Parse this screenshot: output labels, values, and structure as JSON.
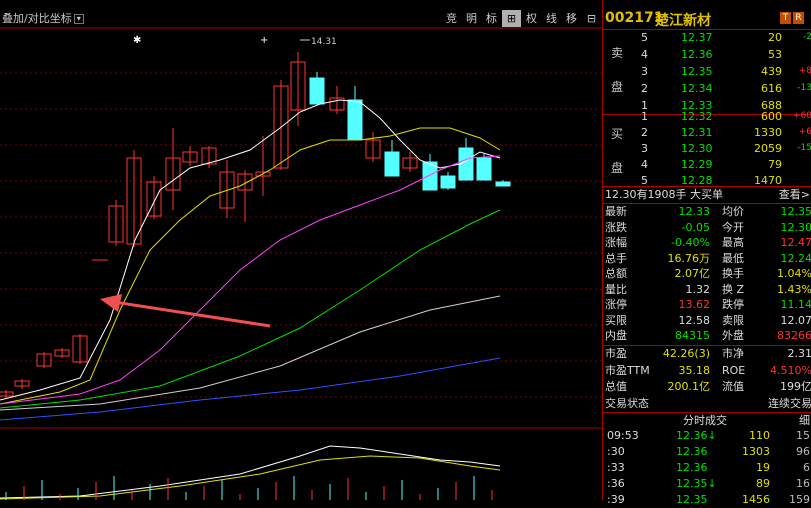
{
  "indicator_label": "叠加/对比坐标",
  "toolbar": [
    "竞",
    "明",
    "标",
    "⊞",
    "权",
    "线",
    "移",
    "⊟"
  ],
  "price_marks": {
    "high_label": "14.31"
  },
  "stock": {
    "code": "002171",
    "name": "楚江新材",
    "badge_t": "T",
    "badge_r": "R"
  },
  "sell_label": [
    "卖",
    "盘"
  ],
  "buy_label": [
    "买",
    "盘"
  ],
  "asks": [
    {
      "level": "5",
      "price": "12.37",
      "vol": "20",
      "chg": "-2"
    },
    {
      "level": "4",
      "price": "12.36",
      "vol": "53",
      "chg": ""
    },
    {
      "level": "3",
      "price": "12.35",
      "vol": "439",
      "chg": "+8"
    },
    {
      "level": "2",
      "price": "12.34",
      "vol": "616",
      "chg": "-13"
    },
    {
      "level": "1",
      "price": "12.33",
      "vol": "688",
      "chg": ""
    }
  ],
  "bids": [
    {
      "level": "1",
      "price": "12.32",
      "vol": "600",
      "chg": "+60"
    },
    {
      "level": "2",
      "price": "12.31",
      "vol": "1330",
      "chg": "+6"
    },
    {
      "level": "3",
      "price": "12.30",
      "vol": "2059",
      "chg": "-15"
    },
    {
      "level": "4",
      "price": "12.29",
      "vol": "79",
      "chg": ""
    },
    {
      "level": "5",
      "price": "12.28",
      "vol": "1470",
      "chg": ""
    }
  ],
  "big_buy": {
    "text": "12.30有1908手 大买单",
    "link": "查看>"
  },
  "quote": [
    {
      "l1": "最新",
      "v1": "12.33",
      "c1": "g",
      "l2": "均价",
      "v2": "12.35",
      "c2": "g"
    },
    {
      "l1": "涨跌",
      "v1": "-0.05",
      "c1": "g",
      "l2": "今开",
      "v2": "12.30",
      "c2": "g"
    },
    {
      "l1": "涨幅",
      "v1": "-0.40%",
      "c1": "g",
      "l2": "最高",
      "v2": "12.47",
      "c2": "r"
    },
    {
      "l1": "总手",
      "v1": "16.76万",
      "c1": "y",
      "l2": "最低",
      "v2": "12.24",
      "c2": "g"
    },
    {
      "l1": "总额",
      "v1": "2.07亿",
      "c1": "y",
      "l2": "换手",
      "v2": "1.04%",
      "c2": "y"
    },
    {
      "l1": "量比",
      "v1": "1.32",
      "c1": "w",
      "l2": "换 Z",
      "v2": "1.43%",
      "c2": "y"
    },
    {
      "l1": "涨停",
      "v1": "13.62",
      "c1": "r",
      "l2": "跌停",
      "v2": "11.14",
      "c2": "g"
    },
    {
      "l1": "买限",
      "v1": "12.58",
      "c1": "w",
      "l2": "卖限",
      "v2": "12.07",
      "c2": "w"
    },
    {
      "l1": "内盘",
      "v1": "84315",
      "c1": "g",
      "l2": "外盘",
      "v2": "83266",
      "c2": "r"
    }
  ],
  "fund": [
    {
      "l1": "市盈",
      "v1": "42.26(3)",
      "l2": "市净",
      "v2": "2.31"
    },
    {
      "l1": "市盈TTM",
      "v1": "35.18",
      "l2": "ROE",
      "v2": "4.510%"
    },
    {
      "l1": "总值",
      "v1": "200.1亿",
      "l2": "流值",
      "v2": "199亿"
    },
    {
      "l1": "交易状态",
      "v1": "",
      "l2": "",
      "v2": "连续交易"
    }
  ],
  "ticks_header": "分时成交",
  "ticks_header_side": "细",
  "ticks": [
    {
      "time": "09:53",
      "price": "12.36",
      "arrow": "↓",
      "vol": "110",
      "n": "15"
    },
    {
      "time": ":30",
      "price": "12.36",
      "arrow": "",
      "vol": "1303",
      "n": "96"
    },
    {
      "time": ":33",
      "price": "12.36",
      "arrow": "",
      "vol": "19",
      "n": "6"
    },
    {
      "time": ":36",
      "price": "12.35",
      "arrow": "↓",
      "vol": "89",
      "n": "16"
    },
    {
      "time": ":39",
      "price": "12.35",
      "arrow": "",
      "vol": "1456",
      "n": "159"
    }
  ]
}
